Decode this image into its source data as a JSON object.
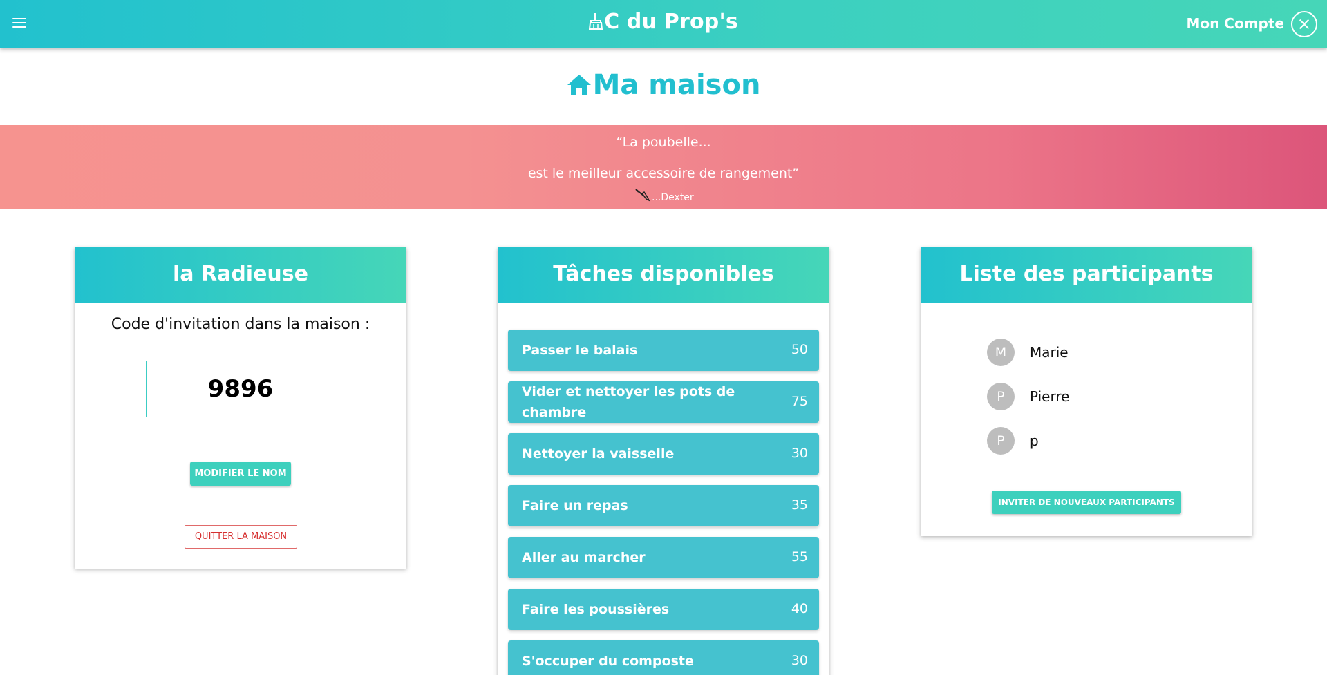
{
  "topbar": {
    "menu_icon": "hamburger-menu-icon",
    "brand_icon": "broom-icon",
    "brand": "C du Prop's",
    "account_label": "Mon Compte",
    "close_icon": "close-circle-icon"
  },
  "page": {
    "title_icon": "home-icon",
    "title": "Ma maison"
  },
  "quote": {
    "line1": "“La poubelle...",
    "line2": "est le meilleur accessoire de rangement”",
    "author_icon": "broom-icon",
    "author": "...Dexter"
  },
  "house": {
    "name": "la Radieuse",
    "invite_label": "Code d'invitation dans la maison :",
    "invite_code": "9896",
    "rename_button": "MODIFIER LE NOM",
    "leave_button": "QUITTER LA MAISON"
  },
  "tasks": {
    "title": "Tâches disponibles",
    "items": [
      {
        "name": "Passer le balais",
        "points": "50"
      },
      {
        "name": "Vider et nettoyer les pots de chambre",
        "points": "75"
      },
      {
        "name": "Nettoyer la vaisselle",
        "points": "30"
      },
      {
        "name": "Faire un repas",
        "points": "35"
      },
      {
        "name": "Aller au marcher",
        "points": "55"
      },
      {
        "name": "Faire les poussières",
        "points": "40"
      },
      {
        "name": "S'occuper du composte",
        "points": "30"
      }
    ]
  },
  "members": {
    "title": "Liste des participants",
    "items": [
      {
        "initial": "M",
        "name": "Marie"
      },
      {
        "initial": "P",
        "name": "Pierre"
      },
      {
        "initial": "P",
        "name": "p"
      }
    ],
    "invite_button": "INVITER DE NOUVEAUX PARTICIPANTS"
  },
  "colors": {
    "primary": "#22c1ce",
    "accent": "#3dd0bd",
    "task_bg": "#45c2cf",
    "quote_start": "#f6938f",
    "quote_end": "#dc557a",
    "danger": "#d62f2f"
  }
}
